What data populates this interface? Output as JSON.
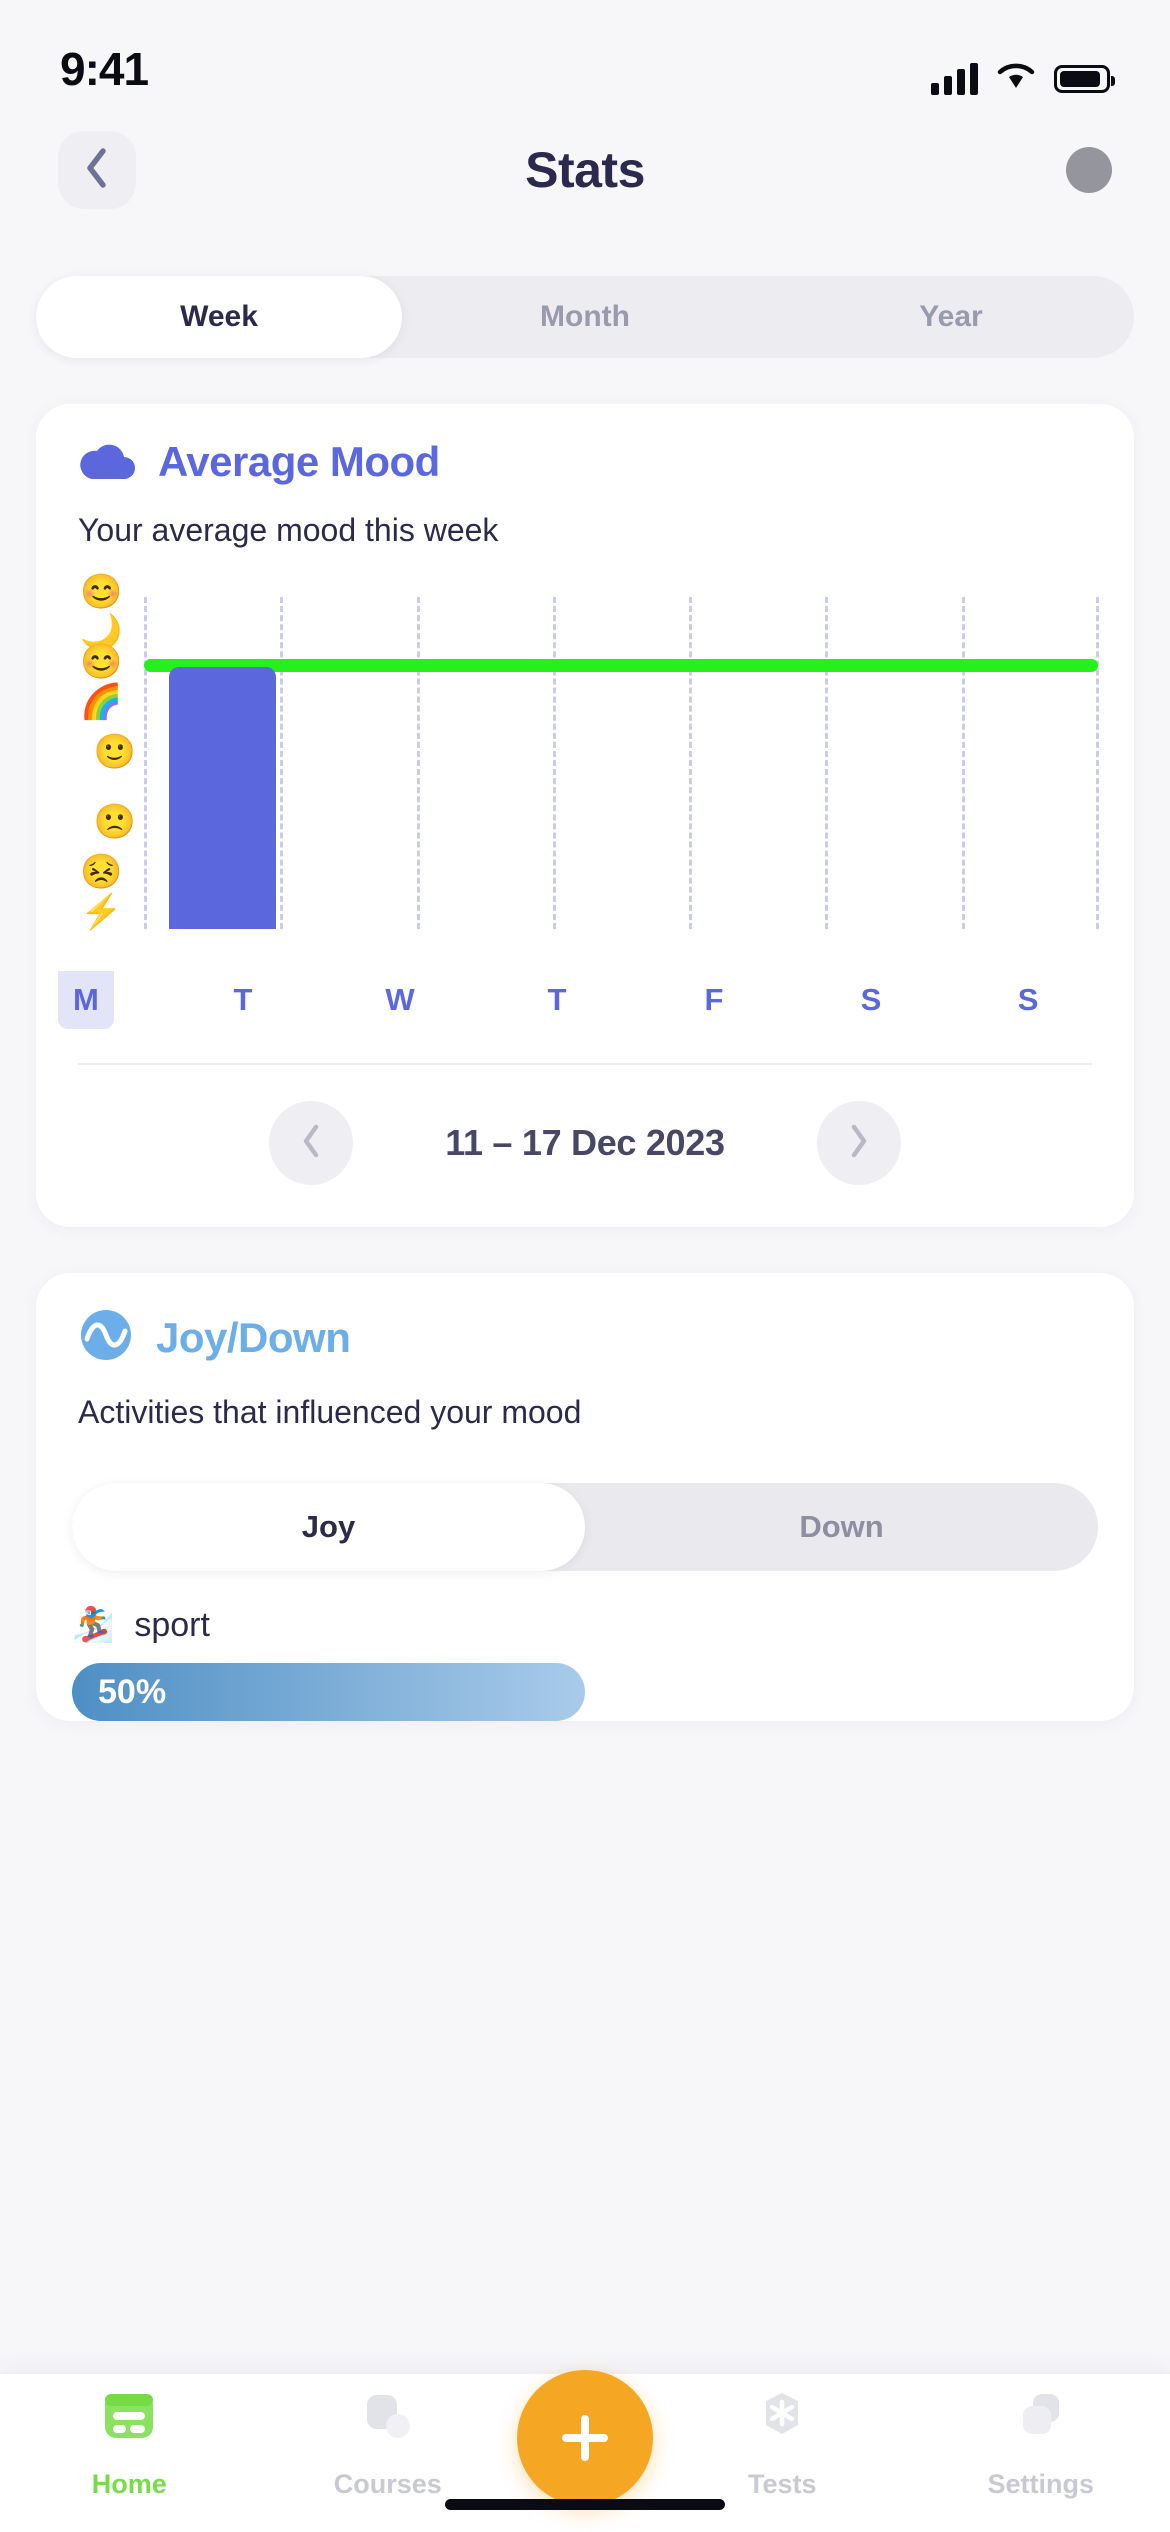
{
  "status_bar": {
    "time": "9:41",
    "signal_icon": "cellular-signal-icon",
    "wifi_icon": "wifi-icon",
    "battery_icon": "battery-icon"
  },
  "header": {
    "back_icon": "chevron-left-icon",
    "title": "Stats",
    "avatar": "user-avatar"
  },
  "period_tabs": {
    "items": [
      {
        "label": "Week",
        "active": true
      },
      {
        "label": "Month",
        "active": false
      },
      {
        "label": "Year",
        "active": false
      }
    ]
  },
  "mood_card": {
    "icon": "cloud-icon",
    "title": "Average Mood",
    "title_color": "#5B67DC",
    "subtitle": "Your average mood this week",
    "date_range": "11 – 17 Dec 2023",
    "prev_icon": "chevron-left-icon",
    "next_icon": "chevron-right-icon"
  },
  "chart_data": {
    "type": "bar",
    "title": "Average Mood",
    "xlabel": "",
    "ylabel": "",
    "categories": [
      "M",
      "T",
      "W",
      "T",
      "F",
      "S",
      "S"
    ],
    "values": [
      4,
      0,
      0,
      0,
      0,
      0,
      0
    ],
    "ylim": [
      0,
      5
    ],
    "ytick_labels": [
      "😊🌙",
      "😊🌈",
      "🙂",
      "🙁",
      "😣⚡"
    ],
    "ytick_values": [
      5,
      4,
      3,
      2,
      1
    ],
    "ytick_names": [
      "happy-moon-face",
      "happy-rainbow-face",
      "neutral-face",
      "sad-face",
      "angry-lightning-face"
    ],
    "grid": "vertical-dashed",
    "legend": "none",
    "bar_color": "#5B67DC",
    "average_line": {
      "value": 4,
      "color": "#25F01C",
      "label": ""
    },
    "selected_category": "M"
  },
  "joy_card": {
    "icon": "wave-circle-icon",
    "title": "Joy/Down",
    "title_color": "#6CAEE8",
    "subtitle": "Activities that influenced your mood",
    "toggle": [
      {
        "label": "Joy",
        "active": true
      },
      {
        "label": "Down",
        "active": false
      }
    ],
    "activities": [
      {
        "icon": "running-person-icon",
        "name": "sport",
        "percent": "50%",
        "value": 50
      }
    ]
  },
  "tab_bar": {
    "items": [
      {
        "label": "Home",
        "icon": "home-icon",
        "active": true
      },
      {
        "label": "Courses",
        "icon": "courses-icon",
        "active": false
      },
      {
        "label": "Tests",
        "icon": "tests-icon",
        "active": false
      },
      {
        "label": "Settings",
        "icon": "settings-icon",
        "active": false
      }
    ],
    "fab": {
      "icon": "plus-icon",
      "color": "#F5A623"
    }
  }
}
